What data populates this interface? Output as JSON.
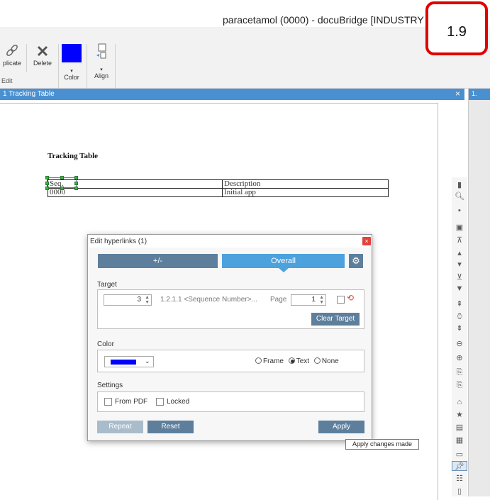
{
  "window": {
    "title": "paracetamol (0000) - docuBridge [INDUSTRY"
  },
  "badge": {
    "label": "1.9"
  },
  "ribbon": {
    "duplicate_label": "plicate",
    "delete_label": "Delete",
    "color_label": "Color",
    "align_label": "Align",
    "edit_group_label": "Edit",
    "accent_color": "#0000ff"
  },
  "panel": {
    "title": "1 Tracking Table",
    "close": "×",
    "right_tab": "1."
  },
  "document": {
    "title": "Tracking Table",
    "table": [
      [
        "Seq.",
        "Description"
      ],
      [
        "0000",
        "Initial app"
      ]
    ]
  },
  "dialog": {
    "title": "Edit hyperlinks (1)",
    "close": "×",
    "tabs": [
      {
        "label": "+/-"
      },
      {
        "label": "Overall"
      }
    ],
    "gear_icon": "gear-icon",
    "target": {
      "label": "Target",
      "seq_value": "3",
      "destination": "1.2.1.1 <Sequence Number>...",
      "page_label": "Page",
      "page_value": "1",
      "clear_button": "Clear Target"
    },
    "color": {
      "label": "Color",
      "swatch": "#0000ff",
      "options": [
        {
          "label": "Frame",
          "selected": false
        },
        {
          "label": "Text",
          "selected": true
        },
        {
          "label": "None",
          "selected": false
        }
      ]
    },
    "settings": {
      "label": "Settings",
      "from_pdf": "From PDF",
      "locked": "Locked"
    },
    "buttons": {
      "repeat": "Repeat",
      "reset": "Reset",
      "apply": "Apply"
    }
  },
  "tooltip": {
    "text": "Apply changes made"
  }
}
